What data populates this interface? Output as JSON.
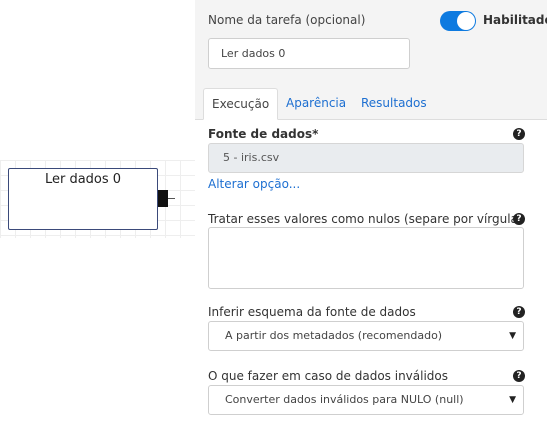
{
  "canvas": {
    "node_title": "Ler dados 0"
  },
  "panel": {
    "task_label": "Nome da tarefa (opcional)",
    "enabled_label": "Habilitado",
    "task_name_value": "Ler dados 0",
    "tabs": [
      {
        "label": "Execução"
      },
      {
        "label": "Aparência"
      },
      {
        "label": "Resultados"
      }
    ],
    "data_source": {
      "label": "Fonte de dados*",
      "value": "5 - iris.csv",
      "change_link": "Alterar opção..."
    },
    "null_values": {
      "label": "Tratar esses valores como nulos (separe por vírgula)",
      "value": ""
    },
    "schema": {
      "label": "Inferir esquema da fonte de dados",
      "selected": "A partir dos metadados (recomendado)"
    },
    "invalid": {
      "label": "O que fazer em caso de dados inválidos",
      "selected": "Converter dados inválidos para NULO (null)"
    },
    "help_glyph": "?",
    "dropdown_glyph": "▼"
  }
}
